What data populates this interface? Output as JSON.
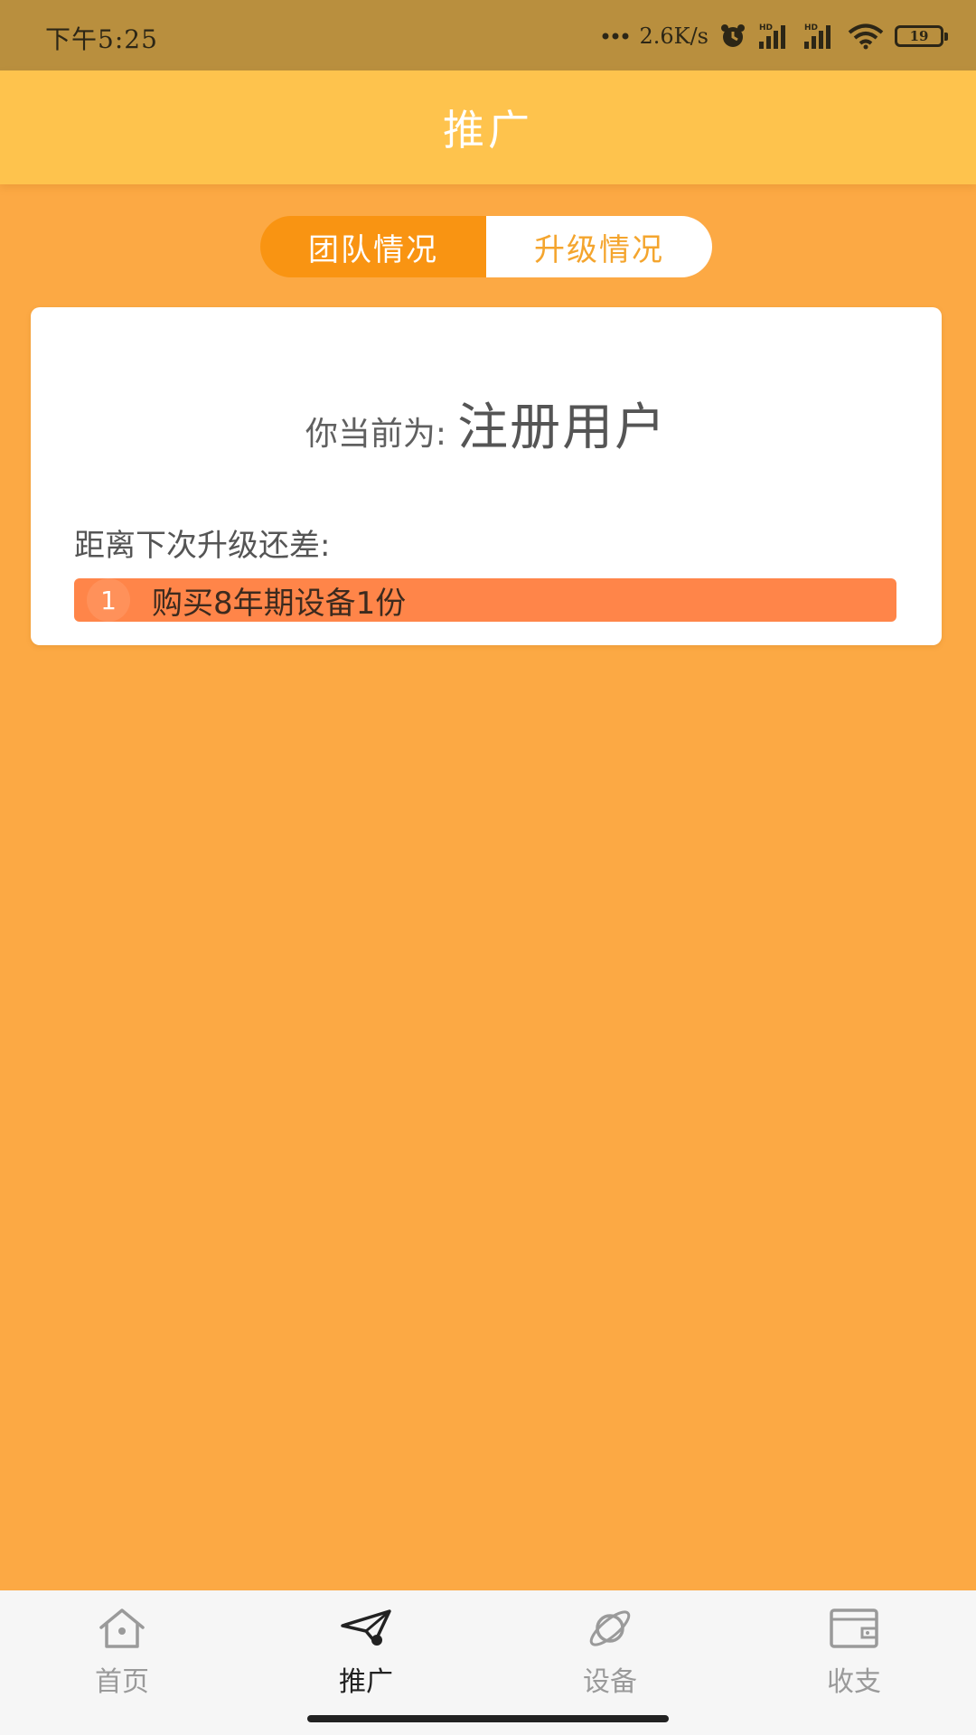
{
  "status_bar": {
    "time": "下午5:25",
    "network_speed": "2.6K/s",
    "signal_labels": [
      "HD",
      "HD"
    ],
    "battery_level": "19"
  },
  "header": {
    "title": "推广"
  },
  "tabs": {
    "items": [
      {
        "label": "团队情况",
        "active": true
      },
      {
        "label": "升级情况",
        "active": false
      }
    ]
  },
  "card": {
    "current_level_label": "你当前为:",
    "current_level_value": "注册用户",
    "next_upgrade_label": "距离下次升级还差:",
    "requirements": [
      {
        "index": "1",
        "text": "购买8年期设备1份"
      }
    ]
  },
  "bottom_nav": {
    "items": [
      {
        "label": "首页",
        "icon": "home-icon",
        "active": false
      },
      {
        "label": "推广",
        "icon": "paper-plane-icon",
        "active": true
      },
      {
        "label": "设备",
        "icon": "planet-icon",
        "active": false
      },
      {
        "label": "收支",
        "icon": "wallet-icon",
        "active": false
      }
    ]
  },
  "colors": {
    "background": "#FCA944",
    "header": "#FEC34D",
    "tab_active": "#F99412",
    "tab_inactive_text": "#F4A52E",
    "requirement_bar": "#FF8549"
  }
}
